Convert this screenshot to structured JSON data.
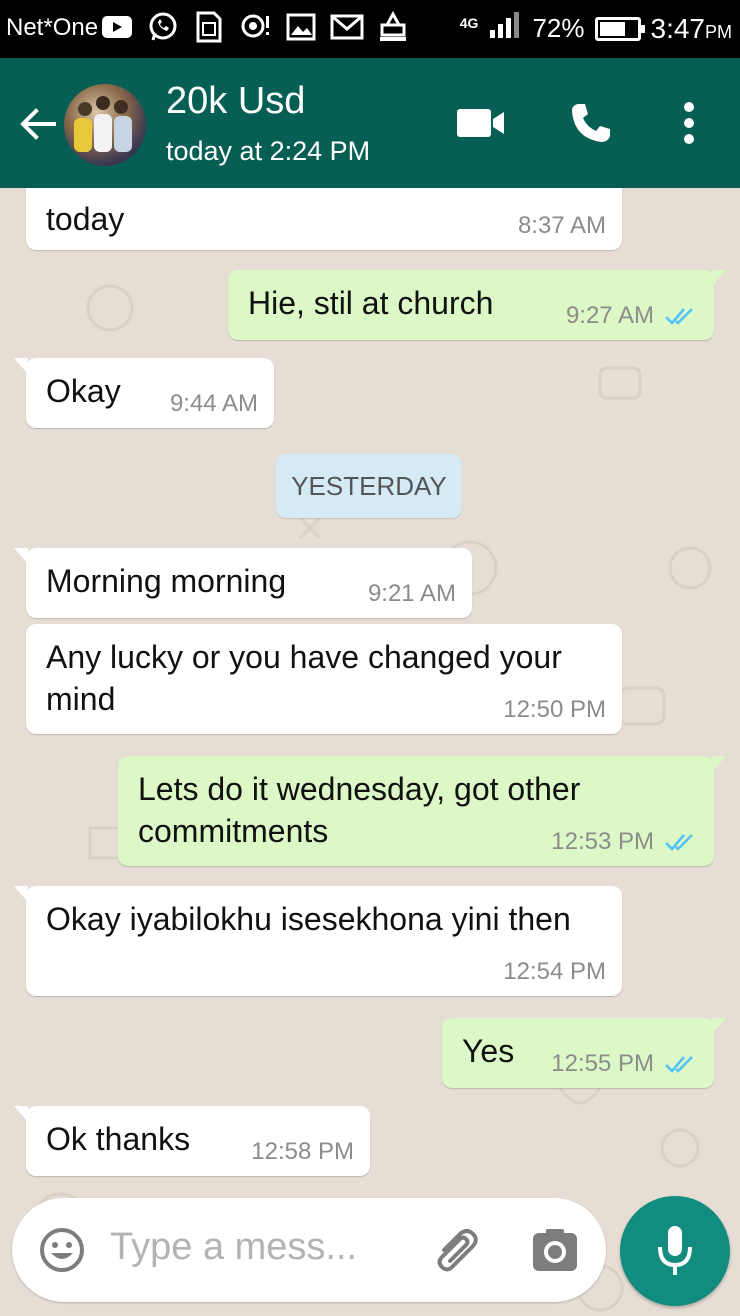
{
  "status_bar": {
    "carrier": "Net*One",
    "network": "4G",
    "battery": "72%",
    "battery_level": 0.72,
    "time": "3:47",
    "ampm": "PM",
    "icons": [
      "youtube-icon",
      "whatsapp-icon",
      "sim-icon",
      "hotspot-icon",
      "gallery-icon",
      "gmail-icon",
      "notification-icon"
    ]
  },
  "header": {
    "contact_name": "20k Usd",
    "last_seen": "today at 2:24 PM",
    "icons": [
      "back-arrow-icon",
      "video-call-icon",
      "voice-call-icon",
      "more-options-icon"
    ]
  },
  "messages": [
    {
      "direction": "in",
      "text": "today",
      "time": "8:37 AM"
    },
    {
      "direction": "out",
      "text": "Hie, stil at church",
      "time": "9:27 AM",
      "status": "read"
    },
    {
      "direction": "in",
      "text": "Okay",
      "time": "9:44 AM"
    },
    {
      "direction": "in",
      "text": "Morning morning",
      "time": "9:21 AM"
    },
    {
      "direction": "in",
      "text": "Any lucky or you have changed your mind",
      "time": "12:50 PM"
    },
    {
      "direction": "out",
      "text": "Lets do it wednesday, got other commitments",
      "time": "12:53 PM",
      "status": "read"
    },
    {
      "direction": "in",
      "text": "Okay iyabilokhu isesekhona yini then",
      "time": "12:54 PM"
    },
    {
      "direction": "out",
      "text": "Yes",
      "time": "12:55 PM",
      "status": "read"
    },
    {
      "direction": "in",
      "text": "Ok thanks",
      "time": "12:58 PM"
    }
  ],
  "date_divider": "YESTERDAY",
  "composer": {
    "placeholder": "Type a mess..."
  },
  "colors": {
    "header": "#075e54",
    "outgoing_bubble": "#dcf8c6",
    "incoming_bubble": "#ffffff",
    "chat_background": "#e6ddd4",
    "mic_button": "#128c7e",
    "read_ticks": "#4fc3f7"
  }
}
